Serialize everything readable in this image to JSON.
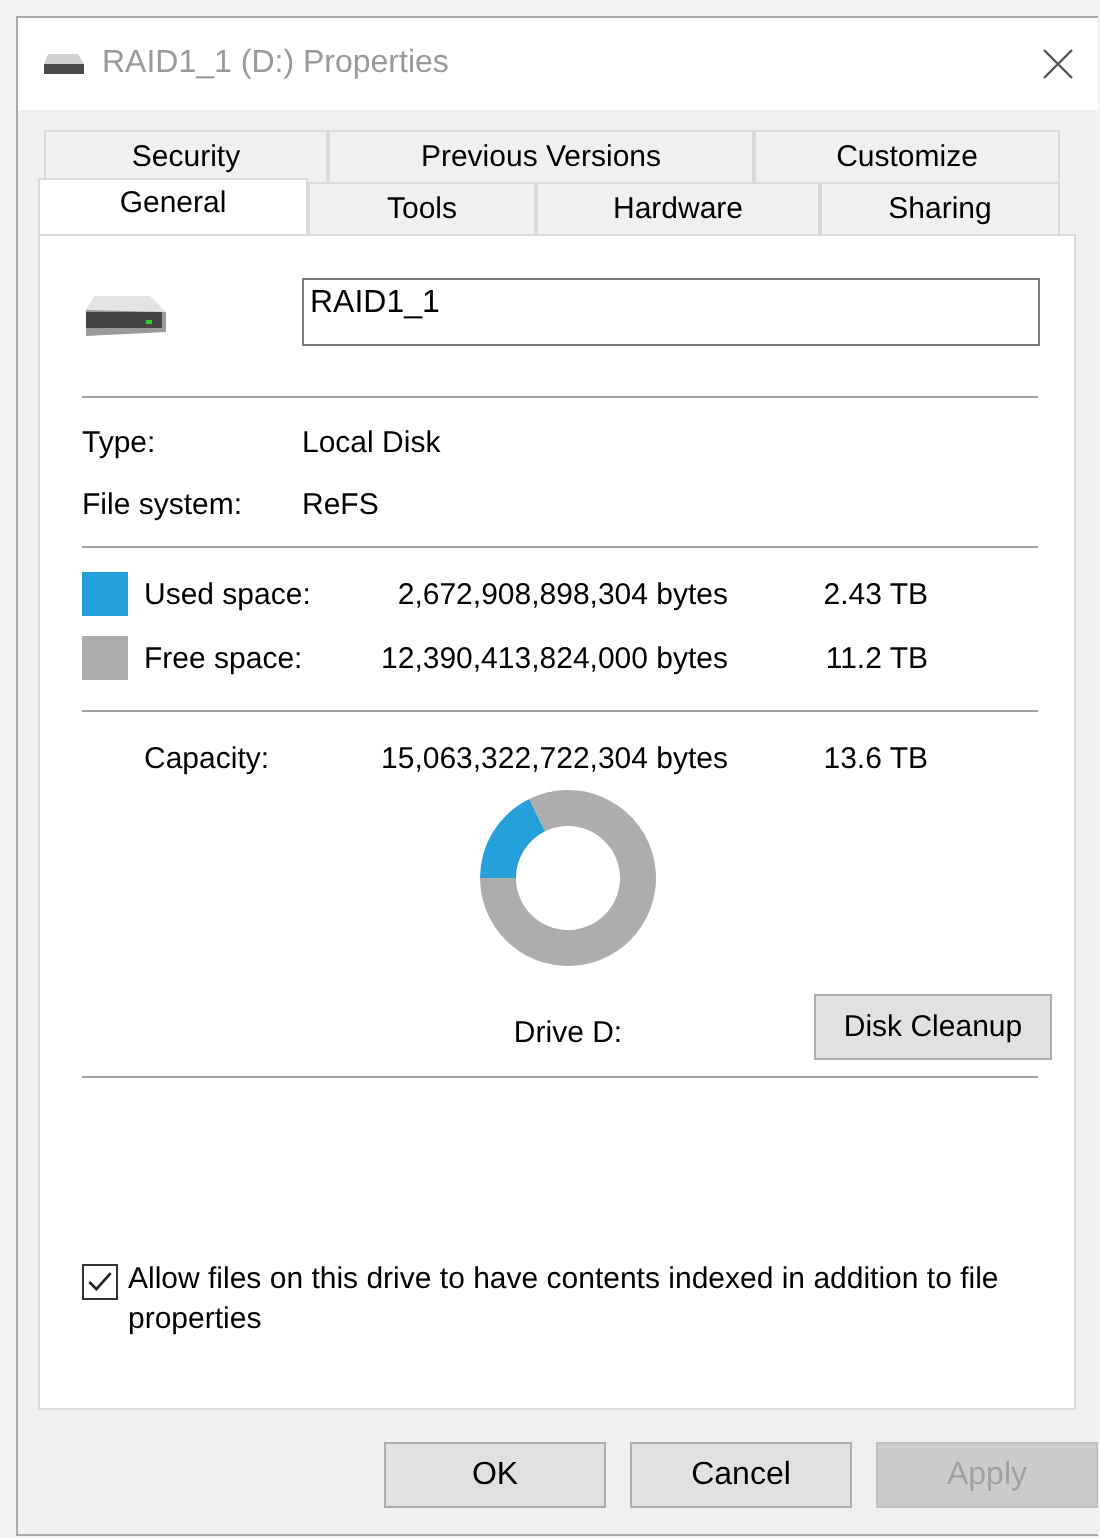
{
  "window": {
    "title": "RAID1_1 (D:) Properties"
  },
  "tab_rows": [
    [
      {
        "label": "Security",
        "selected": false
      },
      {
        "label": "Previous Versions",
        "selected": false
      },
      {
        "label": "Customize",
        "selected": false
      }
    ],
    [
      {
        "label": "General",
        "selected": true
      },
      {
        "label": "Tools",
        "selected": false
      },
      {
        "label": "Hardware",
        "selected": false
      },
      {
        "label": "Sharing",
        "selected": false
      }
    ]
  ],
  "name_field": {
    "value": "RAID1_1"
  },
  "info": [
    {
      "label": "Type:",
      "value": "Local Disk"
    },
    {
      "label": "File system:",
      "value": "ReFS"
    }
  ],
  "space": [
    {
      "label": "Used space:",
      "bytes": "2,672,908,898,304 bytes",
      "size": "2.43 TB",
      "color": "#26a0da"
    },
    {
      "label": "Free space:",
      "bytes": "12,390,413,824,000 bytes",
      "size": "11.2 TB",
      "color": "#adadad"
    }
  ],
  "capacity": {
    "label": "Capacity:",
    "bytes": "15,063,322,722,304 bytes",
    "size": "13.6 TB"
  },
  "chart_data": {
    "type": "donut",
    "values": [
      17.74,
      82.26
    ]
  },
  "drive_label": "Drive D:",
  "cleanup_button": "Disk Cleanup",
  "index_checkbox": {
    "label": "Allow files on this drive to have contents indexed in addition to file properties",
    "checked": true
  },
  "buttons": [
    {
      "label": "OK",
      "disabled": false
    },
    {
      "label": "Cancel",
      "disabled": false
    },
    {
      "label": "Apply",
      "disabled": true
    }
  ]
}
